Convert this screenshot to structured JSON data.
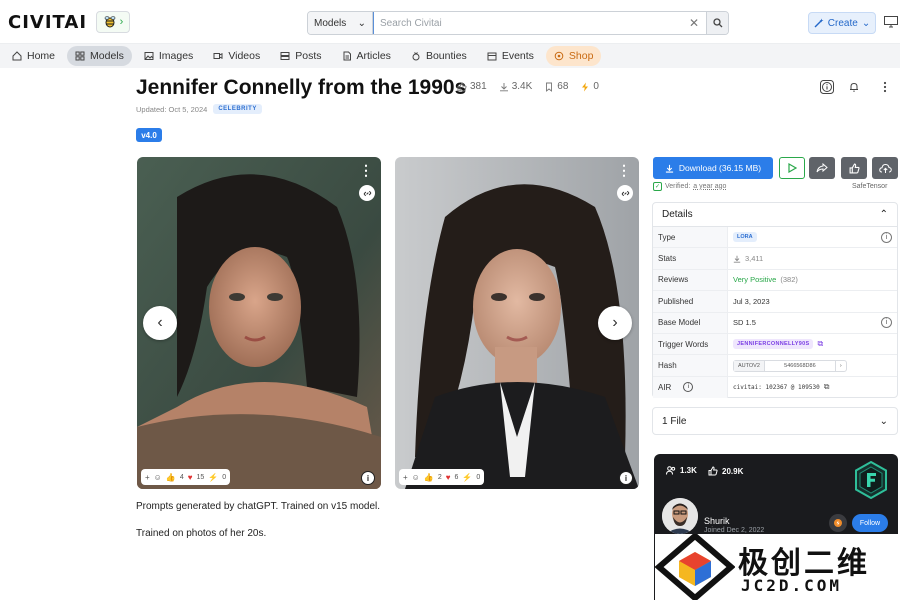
{
  "header": {
    "logo_prefix": "CIVIT",
    "logo_suffix": "AI",
    "search_scope": "Models",
    "search_placeholder": "Search Civitai",
    "create_label": "Create"
  },
  "nav": {
    "tabs": [
      {
        "label": "Home",
        "icon": "home-icon"
      },
      {
        "label": "Models",
        "icon": "grid-icon",
        "active": true
      },
      {
        "label": "Images",
        "icon": "image-icon"
      },
      {
        "label": "Videos",
        "icon": "video-icon"
      },
      {
        "label": "Posts",
        "icon": "posts-icon"
      },
      {
        "label": "Articles",
        "icon": "article-icon"
      },
      {
        "label": "Bounties",
        "icon": "bounty-icon"
      },
      {
        "label": "Events",
        "icon": "calendar-icon"
      },
      {
        "label": "Shop",
        "icon": "shop-icon"
      }
    ]
  },
  "model": {
    "title": "Jennifer Connelly from the 1990s",
    "likes": "381",
    "downloads": "3.4K",
    "bookmarks": "68",
    "buzz": "0",
    "updated": "Updated: Oct 5, 2024",
    "category": "CELEBRITY",
    "version": "v4.0"
  },
  "images": [
    {
      "plus": "+",
      "likes": "4",
      "hearts": "15",
      "buzz": "0"
    },
    {
      "plus": "+",
      "likes": "2",
      "hearts": "6",
      "buzz": "0"
    }
  ],
  "description": {
    "line1": "Prompts generated by chatGPT. Trained on v15 model.",
    "line2": "Trained on photos of her 20s."
  },
  "panel": {
    "download_label": "Download (36.15 MB)",
    "verified_label": "Verified:",
    "verified_time": "a year ago",
    "safetensor": "SafeTensor",
    "details_title": "Details",
    "rows": {
      "type_label": "Type",
      "type_value": "LORA",
      "stats_label": "Stats",
      "stats_value": "3,411",
      "reviews_label": "Reviews",
      "reviews_value": "Very Positive",
      "reviews_count": "(382)",
      "published_label": "Published",
      "published_value": "Jul 3, 2023",
      "base_label": "Base Model",
      "base_value": "SD 1.5",
      "trigger_label": "Trigger Words",
      "trigger_value": "JENNIFERCONNELLY90S",
      "hash_label": "Hash",
      "hash_type": "AUTOV2",
      "hash_value": "5466568D86",
      "air_label": "AIR",
      "air_value": "civitai: 102367 @ 109530"
    },
    "files_label": "1 File"
  },
  "creator": {
    "followers": "1.3K",
    "likes": "20.9K",
    "name": "Shurik",
    "joined": "Joined Dec 2, 2022",
    "follow_label": "Follow"
  },
  "watermark": {
    "title": "极创二维",
    "sub": "JC2D.COM"
  },
  "colors": {
    "accent": "#2b7de9",
    "positive": "#2aa84a",
    "shop": "#c96a12"
  }
}
